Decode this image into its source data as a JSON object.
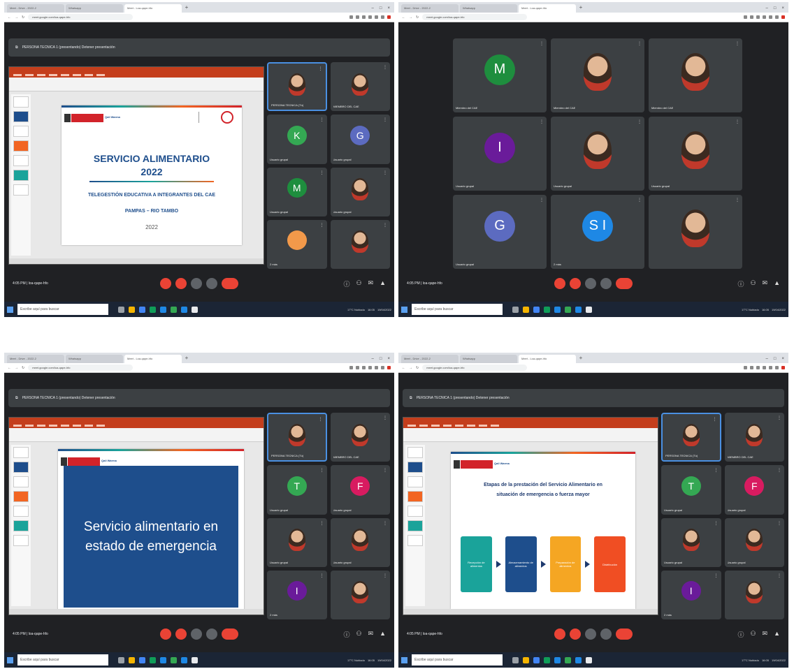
{
  "browser": {
    "tabs": [
      "Meet - Drive - 2022-2",
      "Whatsapp",
      "Meet - Loa-qape-hfo"
    ],
    "url": "meet.google.com/loa-qape-hfo",
    "controls": [
      "–",
      "□",
      "×"
    ]
  },
  "meeting": {
    "code": "4:05 PM | loa-qape-hfo",
    "presenter_banner": "PERSONA TECNICA 1 (presentando) Detener presentación"
  },
  "screens": [
    {
      "slide": {
        "title_line1": "SERVICIO ALIMENTARIO",
        "title_line2": "2022",
        "subtitle": "TELEGESTIÓN EDUCATIVA A INTEGRANTES DEL CAE",
        "place": "PAMPAS – RIO TAMBO",
        "year": "2022",
        "org": "Qali Warma"
      },
      "tiles": [
        {
          "name": "PERSONA TECNICA (Tú)",
          "type": "face",
          "sel": true
        },
        {
          "name": "MIEMBRO DEL CAE",
          "type": "face"
        },
        {
          "name": "Usuario grupal",
          "type": "avatar",
          "letter": "K",
          "color": "#34a853"
        },
        {
          "name": "Usuario grupal",
          "type": "avatar",
          "letter": "G",
          "color": "#5c6bc0"
        },
        {
          "name": "Usuario grupal",
          "type": "avatar",
          "letter": "M",
          "color": "#1e8e3e"
        },
        {
          "name": "Usuario grupal",
          "type": "face"
        },
        {
          "name": "2 más",
          "type": "avatar",
          "letter": "",
          "color": "#f2994a"
        },
        {
          "name": "",
          "type": "face"
        }
      ]
    },
    {
      "tiles": [
        {
          "name": "Miembro del CAE",
          "type": "avatar",
          "letter": "M",
          "color": "#1e8e3e"
        },
        {
          "name": "Miembro del CAE",
          "type": "face"
        },
        {
          "name": "Miembro del CAE",
          "type": "face"
        },
        {
          "name": "Usuario grupal",
          "type": "avatar",
          "letter": "I",
          "color": "#6a1b9a"
        },
        {
          "name": "Usuario grupal",
          "type": "face"
        },
        {
          "name": "Usuario grupal",
          "type": "face"
        },
        {
          "name": "Usuario grupal",
          "type": "avatar",
          "letter": "G",
          "color": "#5c6bc0"
        },
        {
          "name": "2 más",
          "type": "avatar",
          "letter": "S I",
          "color": "#1e88e5"
        },
        {
          "name": "",
          "type": "face"
        }
      ]
    },
    {
      "slide": {
        "blue_text": "Servicio alimentario en estado de emergencia",
        "org": "Qali Warma"
      },
      "tiles": [
        {
          "name": "PERSONA TECNICA (Tú)",
          "type": "face",
          "sel": true
        },
        {
          "name": "MIEMBRO DEL CAE",
          "type": "face"
        },
        {
          "name": "Usuario grupal",
          "type": "avatar",
          "letter": "T",
          "color": "#34a853"
        },
        {
          "name": "Usuario grupal",
          "type": "avatar",
          "letter": "F",
          "color": "#d81b60"
        },
        {
          "name": "Usuario grupal",
          "type": "face"
        },
        {
          "name": "Usuario grupal",
          "type": "face"
        },
        {
          "name": "2 más",
          "type": "avatar",
          "letter": "I",
          "color": "#6a1b9a"
        },
        {
          "name": "",
          "type": "face"
        }
      ]
    },
    {
      "slide": {
        "heading_line1": "Etapas de la prestación del Servicio Alimentario en",
        "heading_line2": "situación de emergencia o fuerza mayor",
        "org": "Qali Warma",
        "boxes": [
          {
            "label": "Recepción de alimentos",
            "color": "#1aa39a"
          },
          {
            "label": "Almacenamiento de alimentos",
            "color": "#1e4e8c"
          },
          {
            "label": "Preparación de alimentos",
            "color": "#f5a623"
          },
          {
            "label": "Distribución",
            "color": "#f04e23"
          }
        ]
      },
      "tiles": [
        {
          "name": "PERSONA TECNICA (Tú)",
          "type": "face",
          "sel": true
        },
        {
          "name": "MIEMBRO DEL CAE",
          "type": "face"
        },
        {
          "name": "Usuario grupal",
          "type": "avatar",
          "letter": "T",
          "color": "#34a853"
        },
        {
          "name": "Usuario grupal",
          "type": "avatar",
          "letter": "F",
          "color": "#d81b60"
        },
        {
          "name": "Usuario grupal",
          "type": "face"
        },
        {
          "name": "Usuario grupal",
          "type": "face"
        },
        {
          "name": "2 más",
          "type": "avatar",
          "letter": "I",
          "color": "#6a1b9a"
        },
        {
          "name": "",
          "type": "face"
        }
      ]
    }
  ],
  "taskbar": {
    "search_placeholder": "Escribe aquí para buscar",
    "weather": "17°C Nublado",
    "time": "16:05",
    "date": "19/04/2022"
  }
}
